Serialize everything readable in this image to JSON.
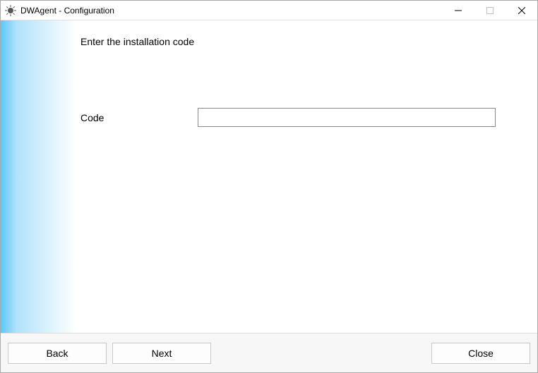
{
  "window": {
    "title": "DWAgent - Configuration"
  },
  "content": {
    "instruction": "Enter the installation code",
    "code_label": "Code",
    "code_value": ""
  },
  "footer": {
    "back": "Back",
    "next": "Next",
    "close": "Close"
  }
}
